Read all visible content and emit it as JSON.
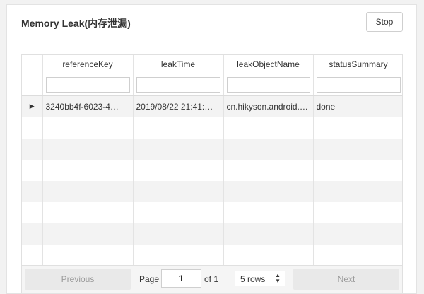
{
  "panel": {
    "title": "Memory Leak(内存泄漏)",
    "stop_label": "Stop"
  },
  "table": {
    "columns": [
      "referenceKey",
      "leakTime",
      "leakObjectName",
      "statusSummary"
    ],
    "rows": [
      {
        "referenceKey": "3240bb4f-6023-4…",
        "leakTime": "2019/08/22 21:41:…",
        "leakObjectName": "cn.hikyson.android.…",
        "statusSummary": "done"
      }
    ]
  },
  "pagination": {
    "previous_label": "Previous",
    "page_label": "Page",
    "page_value": "1",
    "of_label": "of 1",
    "rows_option": "5 rows",
    "next_label": "Next"
  },
  "icons": {
    "expand": "triangle-right-icon",
    "select_arrows": "up-down-arrows-icon"
  }
}
